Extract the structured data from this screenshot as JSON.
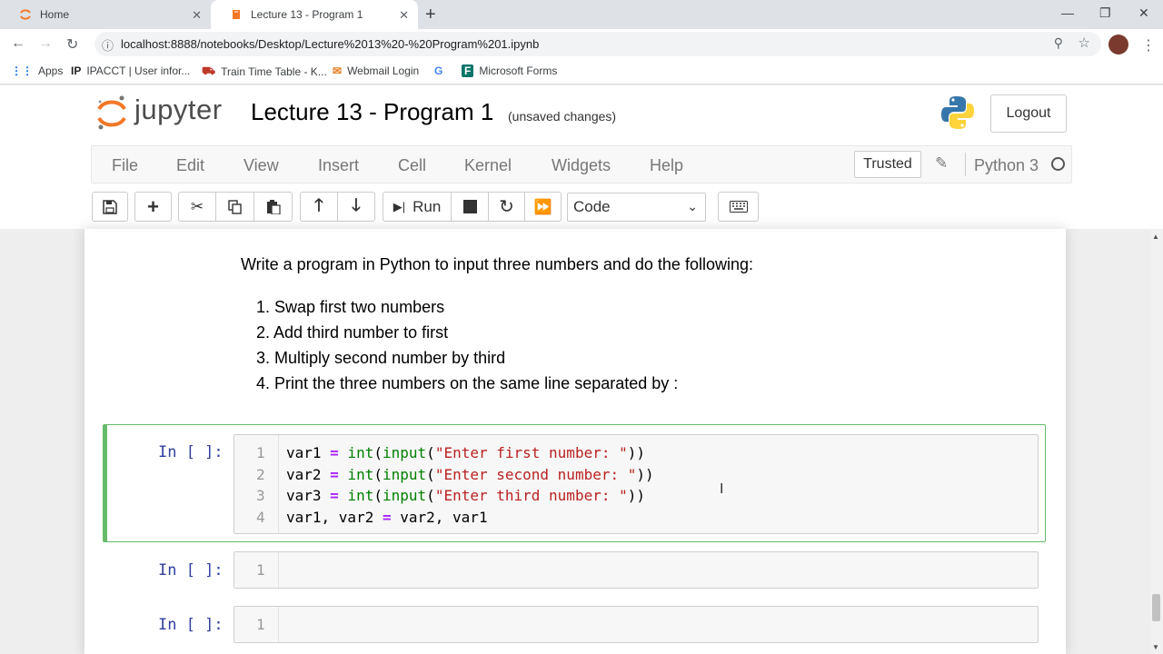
{
  "browser": {
    "tabs": [
      {
        "title": "Home"
      },
      {
        "title": "Lecture 13 - Program 1"
      }
    ],
    "url": "localhost:8888/notebooks/Desktop/Lecture%2013%20-%20Program%201.ipynb",
    "bookmarks": [
      {
        "label": "Apps"
      },
      {
        "label": "IPACCT | User infor..."
      },
      {
        "label": "Train Time Table - K..."
      },
      {
        "label": "Webmail Login"
      },
      {
        "label": "Microsoft Forms"
      }
    ]
  },
  "jupyter": {
    "brand": "jupyter",
    "notebook_title": "Lecture 13 - Program 1",
    "save_status": "(unsaved changes)",
    "logout_label": "Logout",
    "menu": [
      "File",
      "Edit",
      "View",
      "Insert",
      "Cell",
      "Kernel",
      "Widgets",
      "Help"
    ],
    "trusted_label": "Trusted",
    "kernel_name": "Python 3",
    "toolbar": {
      "run_label": "Run",
      "cell_type": "Code"
    }
  },
  "notebook": {
    "markdown": {
      "intro": "Write a program in Python to input three numbers and do the following:",
      "items": [
        "1. Swap first two numbers",
        "2. Add third number to first",
        "3. Multiply second number by third",
        "4. Print the three numbers on the same line separated by :"
      ]
    },
    "cells": [
      {
        "prompt": "In [ ]:",
        "lines": [
          {
            "no": "1",
            "code": "var1 = int(input(\"Enter first number: \"))"
          },
          {
            "no": "2",
            "code": "var2 = int(input(\"Enter second number: \"))"
          },
          {
            "no": "3",
            "code": "var3 = int(input(\"Enter third number: \"))"
          },
          {
            "no": "4",
            "code": "var1, var2 = var2, var1"
          }
        ]
      },
      {
        "prompt": "In [ ]:",
        "lines": [
          {
            "no": "1",
            "code": ""
          }
        ]
      },
      {
        "prompt": "In [ ]:",
        "lines": [
          {
            "no": "1",
            "code": ""
          }
        ]
      }
    ]
  },
  "colors": {
    "selected_cell_border": "#66bb6a",
    "prompt": "#303f9f",
    "keyword": "#008000",
    "string": "#ba2121"
  }
}
